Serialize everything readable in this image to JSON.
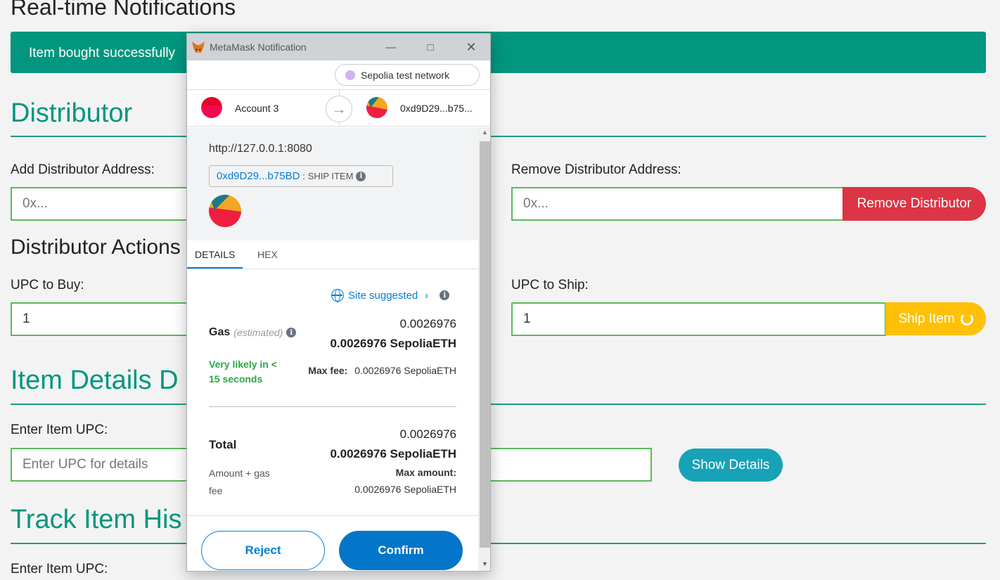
{
  "page": {
    "title": "Real-time Notifications",
    "notification": "Item bought successfully",
    "distributor_section": "Distributor",
    "add_label": "Add Distributor Address:",
    "add_placeholder": "0x...",
    "remove_label": "Remove Distributor Address:",
    "remove_placeholder": "0x...",
    "remove_button": "Remove Distributor",
    "actions_title": "Distributor Actions",
    "buy_label": "UPC to Buy:",
    "buy_value": "1",
    "ship_label": "UPC to Ship:",
    "ship_value": "1",
    "ship_button": "Ship Item",
    "item_details_title": "Item Details D",
    "item_upc_label": "Enter Item UPC:",
    "item_upc_placeholder": "Enter UPC for details",
    "show_details_button": "Show Details",
    "track_title": "Track Item His",
    "track_upc_label": "Enter Item UPC:"
  },
  "metamask": {
    "window_title": "MetaMask Notification",
    "network": "Sepolia test network",
    "from_account": "Account 3",
    "to_address": "0xd9D29...b75...",
    "origin": "http://127.0.0.1:8080",
    "contract_address": "0xd9D29...b75BD",
    "method": ": SHIP ITEM",
    "tabs": [
      "DETAILS",
      "HEX"
    ],
    "site_suggested": "Site suggested",
    "gas_label": "Gas",
    "gas_estimated": "(estimated)",
    "gas_value": "0.0026976",
    "gas_value_bold": "0.0026976 SepoliaETH",
    "likely": "Very likely in < 15 seconds",
    "max_fee_label": "Max fee:",
    "max_fee_value": "0.0026976 SepoliaETH",
    "total_label": "Total",
    "total_value": "0.0026976",
    "total_value_bold": "0.0026976 SepoliaETH",
    "amount_gas": "Amount + gas fee",
    "max_amount_label": "Max amount:",
    "max_amount_value": "0.0026976 SepoliaETH",
    "reject": "Reject",
    "confirm": "Confirm"
  },
  "colors": {
    "teal": "#00967f",
    "red": "#dc3545",
    "yellow": "#ffc107",
    "info": "#17a2b8",
    "metamask_blue": "#037dd6"
  }
}
